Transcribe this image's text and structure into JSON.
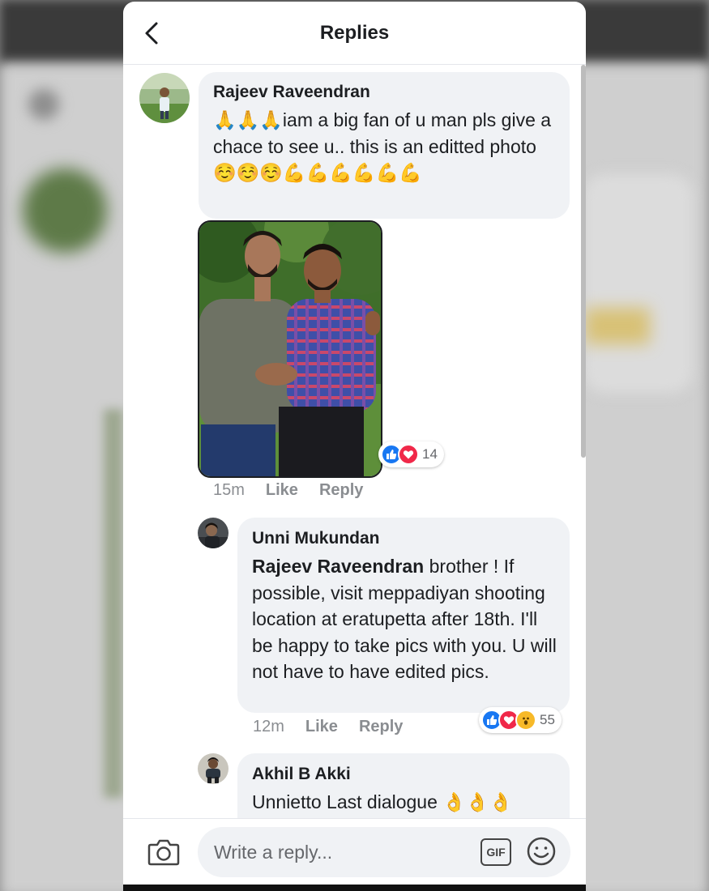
{
  "header": {
    "title": "Replies"
  },
  "comments": [
    {
      "author": "Rajeev Raveendran",
      "text": "🙏🙏🙏iam a big fan of u man pls give a chace to see u.. this is an editted photo☺️☺️☺️💪💪💪💪💪💪",
      "time": "15m",
      "like_label": "Like",
      "reply_label": "Reply",
      "reaction_count": "14"
    },
    {
      "author": "Unni Mukundan",
      "mention": "Rajeev Raveendran",
      "text": " brother ! If possible, visit meppadiyan shooting location at eratupetta after 18th. I'll be happy to take pics with you. U will not have to have edited pics.",
      "time": "12m",
      "like_label": "Like",
      "reply_label": "Reply",
      "reaction_count": "55"
    },
    {
      "author": "Akhil B Akki",
      "text": "Unnietto Last dialogue 👌👌👌"
    }
  ],
  "composer": {
    "placeholder": "Write a reply...",
    "gif_label": "GIF"
  },
  "icons": {
    "back": "chevron-left-icon",
    "camera": "camera-icon",
    "emoji": "smiley-icon",
    "like": "thumbs-up-icon",
    "love": "heart-icon",
    "wow": "wow-icon"
  },
  "colors": {
    "like": "#1877f2",
    "love": "#f02849",
    "wow": "#f7b928",
    "bubble": "#f0f2f5"
  }
}
